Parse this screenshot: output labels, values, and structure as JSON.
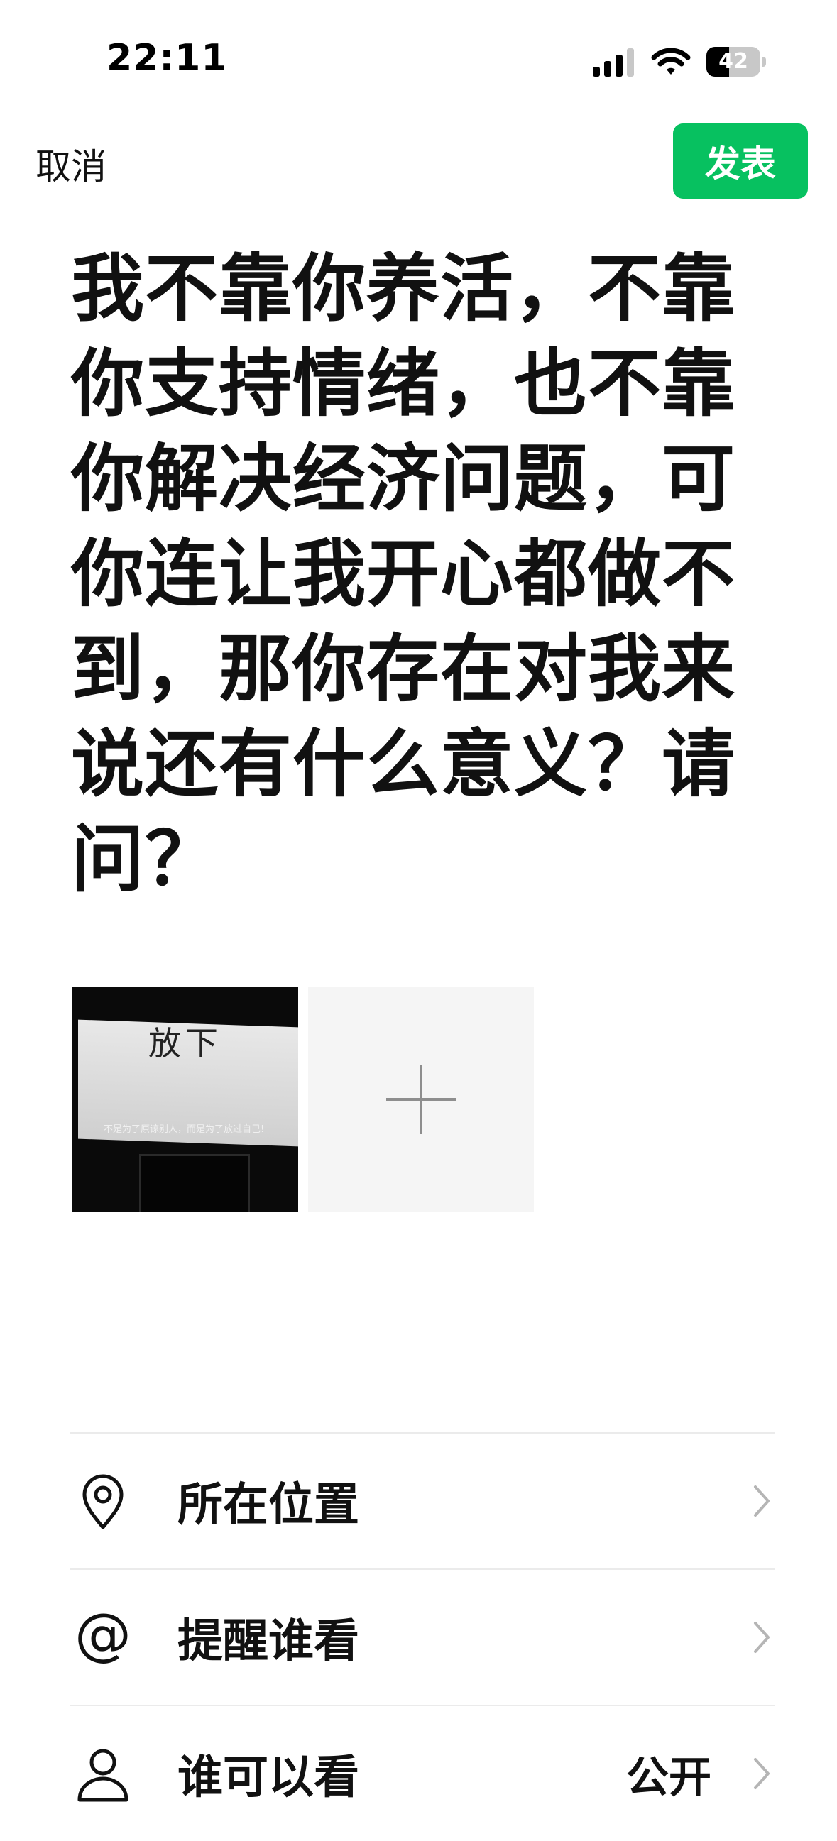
{
  "status_bar": {
    "time": "22:11",
    "battery_level": "42",
    "battery_fraction": 0.42,
    "icons": [
      "signal-icon",
      "wifi-icon",
      "battery-icon"
    ]
  },
  "header": {
    "cancel_label": "取消",
    "publish_label": "发表",
    "publish_color": "#07c160"
  },
  "post": {
    "text": "我不靠你养活，不靠你支持情绪，也不靠你解决经济问题，可你连让我开心都做不到，那你存在对我来说还有什么意义？请问？"
  },
  "media": {
    "thumbnail": {
      "sign_title": "放下",
      "sign_subtitle": "不是为了原谅别人，而是为了放过自己!"
    },
    "add_icon": "plus-icon"
  },
  "options": [
    {
      "icon": "location-pin-icon",
      "label": "所在位置",
      "value": ""
    },
    {
      "icon": "at-icon",
      "label": "提醒谁看",
      "value": ""
    },
    {
      "icon": "person-icon",
      "label": "谁可以看",
      "value": "公开"
    }
  ]
}
